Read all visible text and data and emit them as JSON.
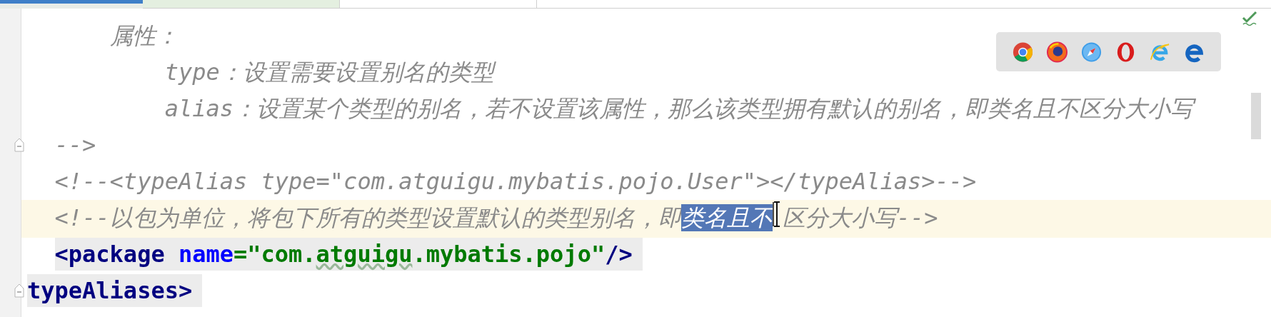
{
  "editor": {
    "lines": [
      {
        "fold": false,
        "current": false,
        "matched": false,
        "segments": [
          {
            "kind": "comment",
            "text": "      属性："
          }
        ]
      },
      {
        "fold": false,
        "current": false,
        "matched": false,
        "segments": [
          {
            "kind": "comment",
            "text": "          type：设置需要设置别名的类型"
          }
        ]
      },
      {
        "fold": false,
        "current": false,
        "matched": false,
        "segments": [
          {
            "kind": "comment",
            "text": "          alias：设置某个类型的别名，若不设置该属性，那么该类型拥有默认的别名，即类名且不区分大小写"
          }
        ]
      },
      {
        "fold": true,
        "current": false,
        "matched": false,
        "segments": [
          {
            "kind": "comment",
            "text": "  -->"
          }
        ]
      },
      {
        "fold": false,
        "current": false,
        "matched": false,
        "segments": [
          {
            "kind": "comment",
            "text": "  <!--<typeAlias type=\"com.atguigu.mybatis.pojo.User\"></typeAlias>-->"
          }
        ]
      },
      {
        "fold": false,
        "current": true,
        "matched": false,
        "segments": [
          {
            "kind": "comment",
            "text": "  <!--以包为单位，将包下所有的类型设置默认的类型别名，即",
            "selected": false,
            "caret": false
          },
          {
            "kind": "comment",
            "text": "类名且不",
            "selected": true,
            "caret": true
          },
          {
            "kind": "comment",
            "text": "区分大小写-->",
            "selected": false,
            "caret": false
          }
        ]
      },
      {
        "fold": false,
        "current": false,
        "matched": true,
        "segments": [
          {
            "kind": "tag",
            "text": "  <package"
          },
          {
            "kind": "attr",
            "text": " name"
          },
          {
            "kind": "value",
            "text": "=\"com."
          },
          {
            "kind": "value",
            "text": "atguigu",
            "typo": true
          },
          {
            "kind": "value",
            "text": ".mybatis.pojo\""
          },
          {
            "kind": "tag",
            "text": "/>"
          }
        ]
      },
      {
        "fold": true,
        "current": false,
        "matched": true,
        "segments": [
          {
            "kind": "tag",
            "text": "typeAliases>"
          }
        ]
      }
    ]
  }
}
